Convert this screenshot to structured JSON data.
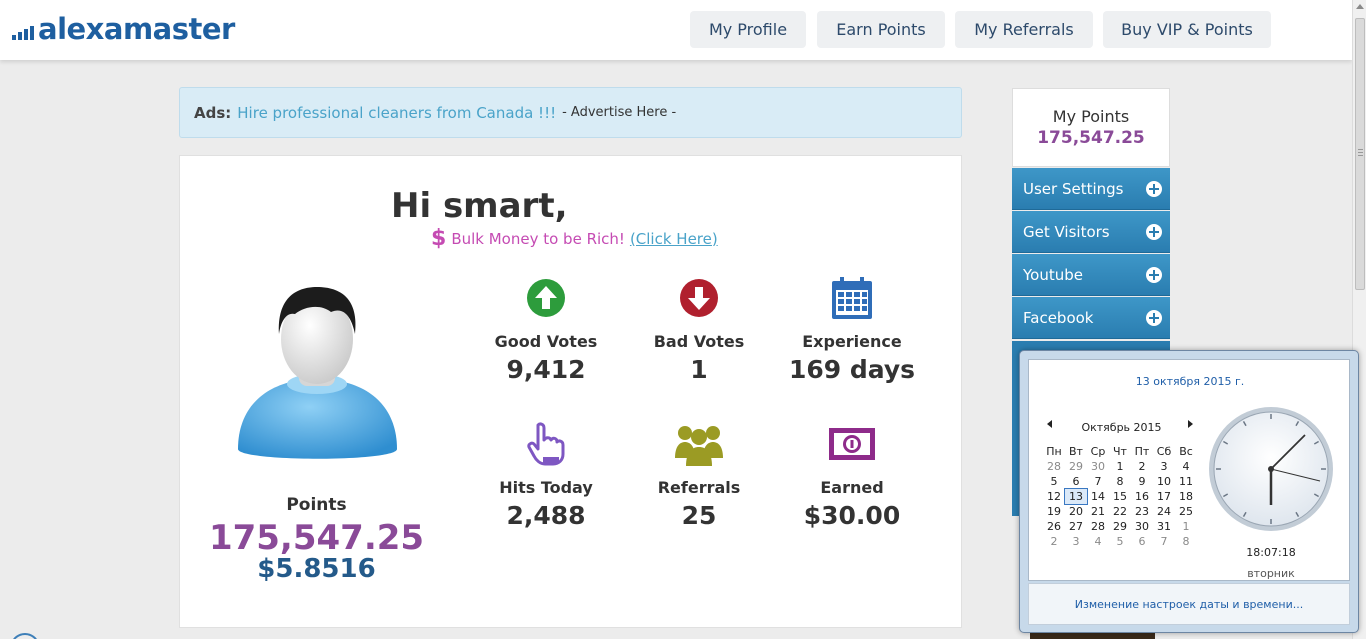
{
  "header": {
    "logo": "alexamaster",
    "nav": [
      {
        "label": "My Profile"
      },
      {
        "label": "Earn Points"
      },
      {
        "label": "My Referrals"
      },
      {
        "label": "Buy VIP & Points"
      }
    ]
  },
  "ads": {
    "label": "Ads:",
    "link": "Hire professional cleaners from Canada !!!",
    "advertise": "- Advertise Here -"
  },
  "main": {
    "greeting": "Hi smart,",
    "bulk_text": "Bulk Money to be Rich!",
    "bulk_link": "(Click Here)",
    "points_label": "Points",
    "points_value": "175,547.25",
    "points_usd": "$5.8516",
    "stats": [
      {
        "label": "Good Votes",
        "value": "9,412",
        "icon": "thumbs-up-icon",
        "color": "#2d9c3c"
      },
      {
        "label": "Bad Votes",
        "value": "1",
        "icon": "thumbs-down-icon",
        "color": "#b0202e"
      },
      {
        "label": "Experience",
        "value": "169 days",
        "icon": "calendar-icon",
        "color": "#2f6db8"
      },
      {
        "label": "Hits Today",
        "value": "2,488",
        "icon": "pointer-hand-icon",
        "color": "#7e57c2"
      },
      {
        "label": "Referrals",
        "value": "25",
        "icon": "group-icon",
        "color": "#9b9b24"
      },
      {
        "label": "Earned",
        "value": "$30.00",
        "icon": "banknote-icon",
        "color": "#8e2b8a"
      }
    ]
  },
  "sidebar": {
    "mypoints_title": "My Points",
    "mypoints_value": "175,547.25",
    "items": [
      {
        "label": "User Settings"
      },
      {
        "label": "Get Visitors"
      },
      {
        "label": "Youtube"
      },
      {
        "label": "Facebook"
      }
    ]
  },
  "calendar": {
    "date_title": "13 октября 2015 г.",
    "month": "Октябрь 2015",
    "weekdays": [
      "Пн",
      "Вт",
      "Ср",
      "Чт",
      "Пт",
      "Сб",
      "Вс"
    ],
    "weeks": [
      [
        "28",
        "29",
        "30",
        "1",
        "2",
        "3",
        "4"
      ],
      [
        "5",
        "6",
        "7",
        "8",
        "9",
        "10",
        "11"
      ],
      [
        "12",
        "13",
        "14",
        "15",
        "16",
        "17",
        "18"
      ],
      [
        "19",
        "20",
        "21",
        "22",
        "23",
        "24",
        "25"
      ],
      [
        "26",
        "27",
        "28",
        "29",
        "30",
        "31",
        "1"
      ],
      [
        "2",
        "3",
        "4",
        "5",
        "6",
        "7",
        "8"
      ]
    ],
    "today": "13",
    "time": "18:07:18",
    "day": "вторник",
    "footer_link": "Изменение настроек даты и времени..."
  },
  "colors": {
    "brand": "#1e5fa0",
    "points_purple": "#8a4a98",
    "sidebar_blue": "#2a7db0"
  }
}
